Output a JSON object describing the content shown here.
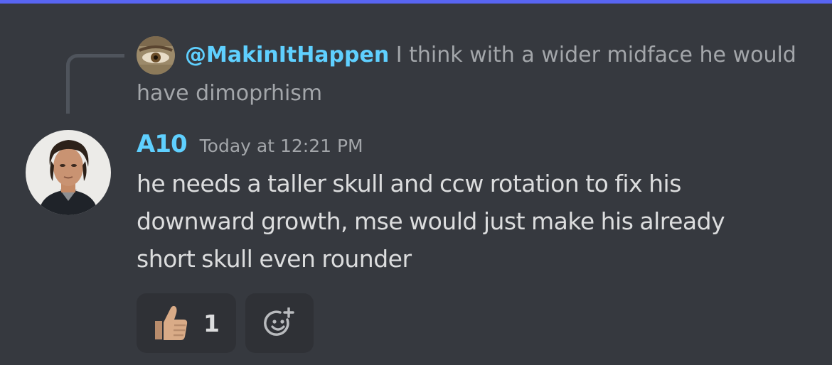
{
  "colors": {
    "background": "#36393f",
    "accent_bar": "#5865f2",
    "username": "#5fd0ff",
    "muted_text": "#a3a6aa",
    "message_text": "#dcddde",
    "reaction_bg": "#2f3136"
  },
  "reply": {
    "author": "@MakinItHappen",
    "text_line1": "I think with a wider midface he would",
    "text_line2": "have dimoprhism",
    "avatar_icon": "user-avatar"
  },
  "message": {
    "author": "A10",
    "timestamp": "Today at 12:21 PM",
    "avatar_icon": "user-avatar",
    "lines": [
      "he needs a taller skull and ccw rotation to fix his",
      "downward growth, mse would just make his already",
      "short skull even rounder"
    ]
  },
  "reactions": [
    {
      "emoji_icon": "thumbs-up-icon",
      "count": "1"
    }
  ],
  "add_reaction": {
    "icon": "add-reaction-icon"
  }
}
